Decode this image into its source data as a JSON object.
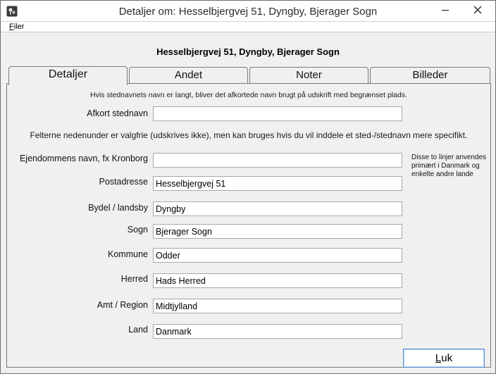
{
  "window": {
    "title": "Detaljer om:  Hesselbjergvej 51, Dyngby, Bjerager Sogn"
  },
  "menu": {
    "file_accel": "F",
    "file_rest": "iler"
  },
  "heading": "Hesselbjergvej 51, Dyngby, Bjerager Sogn",
  "tabs": [
    {
      "label": "Detaljer",
      "active": true
    },
    {
      "label": "Andet",
      "active": false
    },
    {
      "label": "Noter",
      "active": false
    },
    {
      "label": "Billeder",
      "active": false
    }
  ],
  "notes": {
    "short_name_hint": "Hvis stednavnets navn er langt, bliver det afkortede navn brugt på udskrift med begrænset plads.",
    "optional_hint": "Felterne nedenunder er valgfrie (udskrives ikke), men kan bruges hvis du vil inddele et sted-/stednavn mere specifikt.",
    "side_note": "Disse to linjer anvendes primært i Danmark og enkelte andre lande"
  },
  "fields": {
    "short_name": {
      "label": "Afkort stednavn",
      "value": ""
    },
    "property_name": {
      "label": "Ejendommens navn, fx Kronborg",
      "value": ""
    },
    "postal_address": {
      "label": "Postadresse",
      "value": "Hesselbjergvej 51"
    },
    "district": {
      "label": "Bydel / landsby",
      "value": "Dyngby"
    },
    "parish": {
      "label": "Sogn",
      "value": "Bjerager Sogn"
    },
    "municipality": {
      "label": "Kommune",
      "value": "Odder"
    },
    "hundred": {
      "label": "Herred",
      "value": "Hads Herred"
    },
    "county": {
      "label": "Amt / Region",
      "value": "Midtjylland"
    },
    "country": {
      "label": "Land",
      "value": "Danmark"
    }
  },
  "buttons": {
    "close_accel": "L",
    "close_rest": "uk"
  }
}
